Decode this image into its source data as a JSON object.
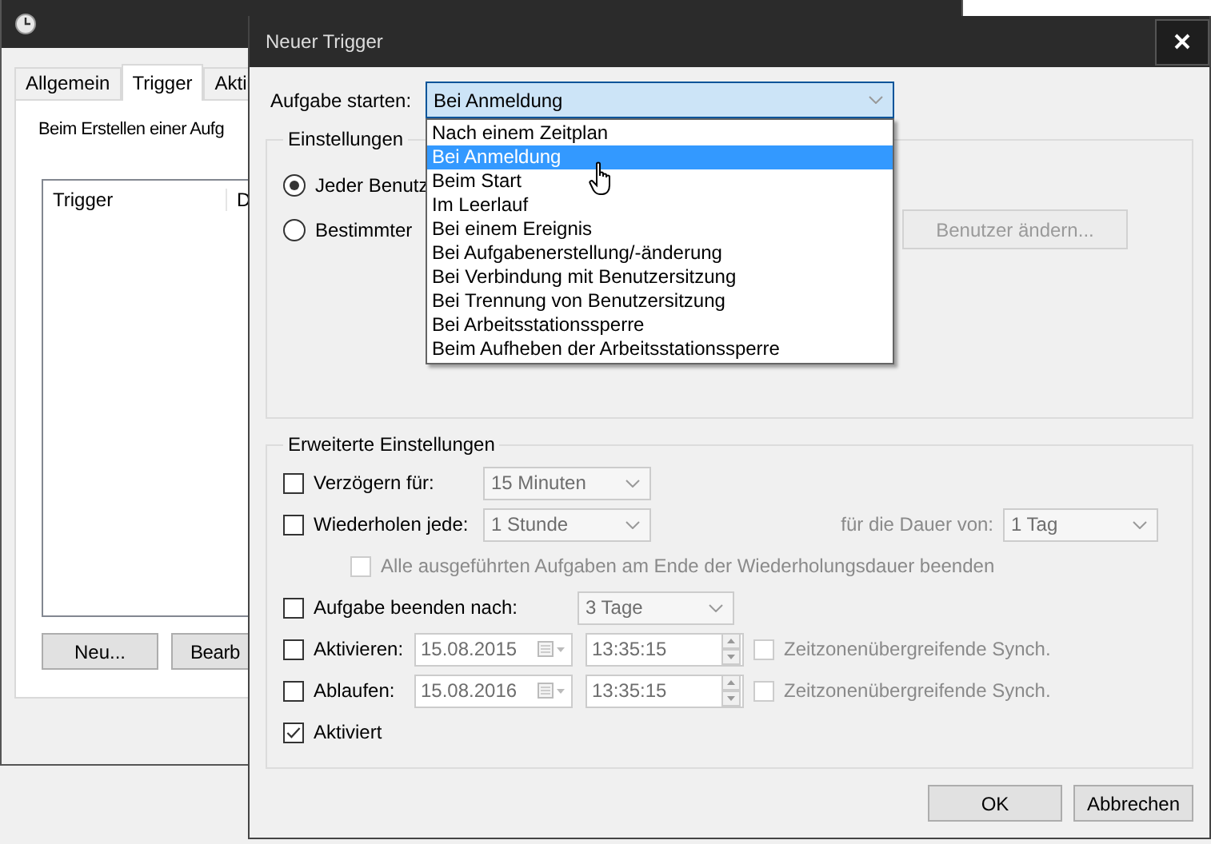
{
  "background_window": {
    "tabs": [
      {
        "label": "Allgemein",
        "selected": false
      },
      {
        "label": "Trigger",
        "selected": true
      },
      {
        "label": "Akti",
        "selected": false
      }
    ],
    "description": "Beim Erstellen einer Aufg",
    "table": {
      "columns": [
        "Trigger",
        "D"
      ]
    },
    "buttons": [
      "Neu...",
      "Bearb"
    ]
  },
  "dialog": {
    "title": "Neuer Trigger",
    "start": {
      "label": "Aufgabe starten:",
      "value": "Bei Anmeldung",
      "expanded": true,
      "options": [
        {
          "label": "Nach einem Zeitplan",
          "selected": false
        },
        {
          "label": "Bei Anmeldung",
          "selected": true
        },
        {
          "label": "Beim Start",
          "selected": false
        },
        {
          "label": "Im Leerlauf",
          "selected": false
        },
        {
          "label": "Bei einem Ereignis",
          "selected": false
        },
        {
          "label": "Bei Aufgabenerstellung/-änderung",
          "selected": false
        },
        {
          "label": "Bei Verbindung mit Benutzersitzung",
          "selected": false
        },
        {
          "label": "Bei Trennung von Benutzersitzung",
          "selected": false
        },
        {
          "label": "Bei Arbeitsstationssperre",
          "selected": false
        },
        {
          "label": "Beim Aufheben der Arbeitsstationssperre",
          "selected": false
        }
      ]
    },
    "settings": {
      "title": "Einstellungen",
      "radios": [
        {
          "label": "Jeder Benutz",
          "selected": true
        },
        {
          "label": "Bestimmter",
          "selected": false
        }
      ],
      "change_user_button": {
        "label": "Benutzer ändern...",
        "disabled": true
      }
    },
    "advanced": {
      "title": "Erweiterte Einstellungen",
      "rows": [
        {
          "kind": "combo",
          "label": "Verzögern für:",
          "checked": false,
          "value": "15 Minuten"
        },
        {
          "kind": "repeat",
          "label": "Wiederholen jede:",
          "checked": false,
          "value": "1 Stunde",
          "duration_label": "für die Dauer von:",
          "duration_value": "1 Tag"
        },
        {
          "kind": "sub_check",
          "label": "Alle ausgeführten Aufgaben am Ende der Wiederholungsdauer beenden",
          "checked": false,
          "disabled": true
        },
        {
          "kind": "combo_wide",
          "label": "Aufgabe beenden nach:",
          "checked": false,
          "value": "3 Tage"
        },
        {
          "kind": "datetime",
          "label": "Aktivieren:",
          "checked": false,
          "date": "15.08.2015",
          "time": "13:35:15",
          "sync_label": "Zeitzonenübergreifende Synch.",
          "sync_checked": false
        },
        {
          "kind": "datetime",
          "label": "Ablaufen:",
          "checked": false,
          "date": "15.08.2016",
          "time": "13:35:15",
          "sync_label": "Zeitzonenübergreifende Synch.",
          "sync_checked": false
        },
        {
          "kind": "check",
          "label": "Aktiviert",
          "checked": true
        }
      ]
    },
    "buttons": [
      "OK",
      "Abbrechen"
    ]
  }
}
